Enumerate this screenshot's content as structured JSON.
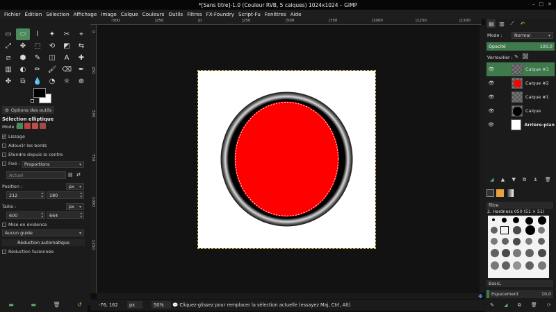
{
  "window": {
    "title": "*[Sans titre]-1.0 (Couleur RVB, 5 calques) 1024x1024 – GIMP",
    "controls": [
      "–",
      "□",
      "✕"
    ]
  },
  "menu": [
    "Fichier",
    "Édition",
    "Sélection",
    "Affichage",
    "Image",
    "Calque",
    "Couleurs",
    "Outils",
    "Filtres",
    "FX-Foundry",
    "Script-Fu",
    "Fenêtres",
    "Aide"
  ],
  "tools": [
    "▭",
    "⬭",
    "⌇",
    "✦",
    "✂",
    "⌖",
    "⤢",
    "✥",
    "⬚",
    "⟲",
    "◩",
    "⇆",
    "⧄",
    "⬢",
    "✎",
    "◫",
    "A",
    "✚",
    "▥",
    "◐",
    "✏",
    "🖌",
    "⌫",
    "✒",
    "✤",
    "⧉",
    "💧",
    "◔",
    "☼",
    "⊕"
  ],
  "tool_options": {
    "tab_label": "Options des outils",
    "title": "Sélection elliptique",
    "mode_label": "Mode :",
    "antialias": "Lissage",
    "feather": "Adoucir les bords",
    "expand_center": "Étendre depuis le centre",
    "fixed_label": "Fixé :",
    "fixed_value": "Proportions",
    "current_value": "Actuel",
    "position_label": "Position :",
    "position_unit": "px",
    "pos_x": "212",
    "pos_y": "180",
    "size_label": "Taille :",
    "size_unit": "px",
    "size_w": "600",
    "size_h": "664",
    "highlight": "Mise en évidence",
    "guides": "Aucun guide",
    "auto_shrink": "Réduction automatique",
    "merged_shrink": "Réduction fusionnée"
  },
  "rulers": {
    "top": [
      "-500",
      "|250",
      "|0",
      "|250",
      "|500",
      "|750",
      "|1000",
      "|1250",
      "|1500"
    ],
    "left": [
      "0",
      "250",
      "500",
      "750",
      "1000",
      "1250"
    ]
  },
  "status": {
    "coords": "-76, 162",
    "unit": "px",
    "zoom": "50%",
    "message": "Cliquez-glissez pour remplacer la sélection actuelle (essayez Maj, Ctrl, Alt)"
  },
  "dock": {
    "mode_label": "Mode :",
    "mode_value": "Normal",
    "opacity_label": "Opacité",
    "opacity_value": "100,0",
    "lock_label": "Verrouiller :",
    "layers": [
      {
        "name": "Calque #3",
        "active": true
      },
      {
        "name": "Calque #2",
        "active": false
      },
      {
        "name": "Calque #1",
        "active": false
      },
      {
        "name": "Calque",
        "active": false
      },
      {
        "name": "Arrière-plan",
        "active": false
      }
    ],
    "brush_filter": "filtre",
    "brush_name": "2. Hardness 050 (51 × 51)",
    "preset": "Basic,",
    "spacing_label": "Espacement",
    "spacing_value": "10,0"
  },
  "colors": {
    "accent": "#4b8a5c",
    "circle_fill": "#ff0000",
    "foreground": "#000000",
    "background": "#ffffff"
  }
}
